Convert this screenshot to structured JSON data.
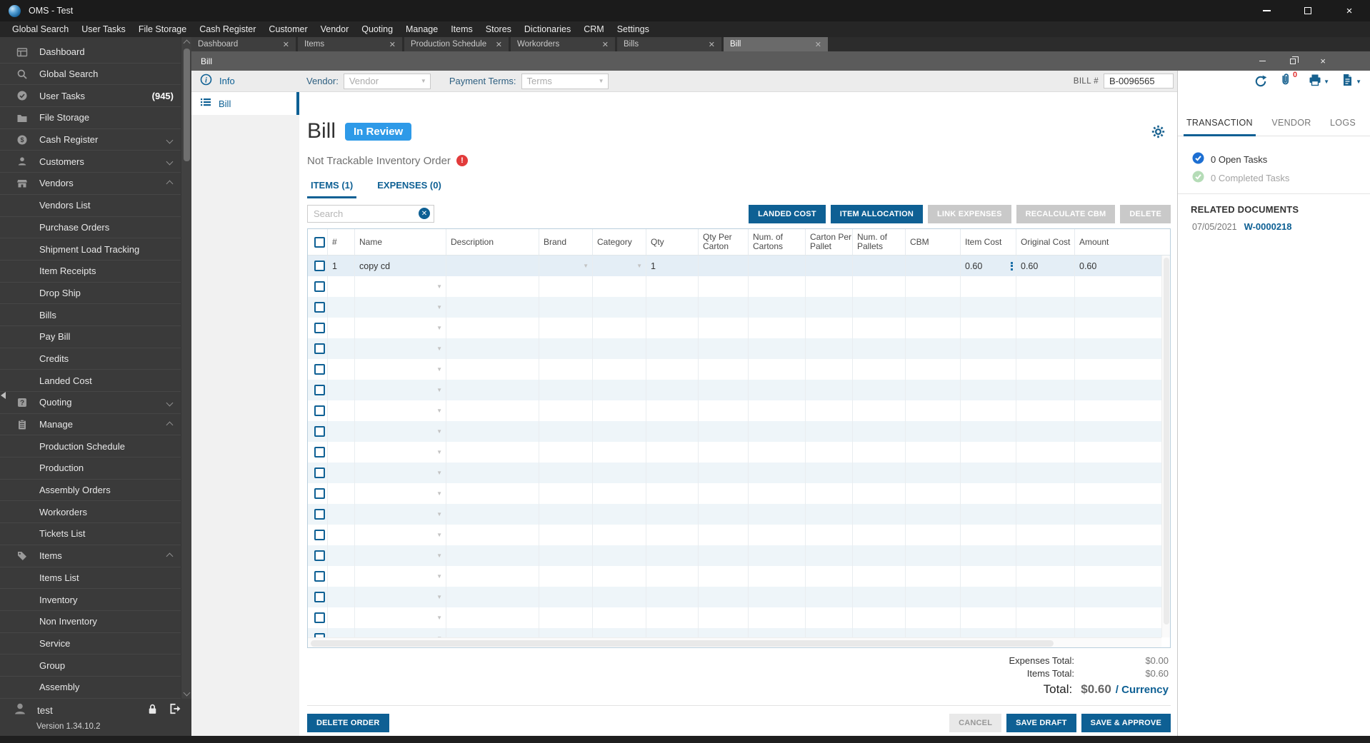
{
  "window": {
    "title": "OMS - Test"
  },
  "menu_bar": [
    "Global Search",
    "User Tasks",
    "File Storage",
    "Cash Register",
    "Customer",
    "Vendor",
    "Quoting",
    "Manage",
    "Items",
    "Stores",
    "Dictionaries",
    "CRM",
    "Settings"
  ],
  "tabs": [
    {
      "label": "Dashboard",
      "active": false
    },
    {
      "label": "Items",
      "active": false
    },
    {
      "label": "Production Schedule",
      "active": false
    },
    {
      "label": "Workorders",
      "active": false
    },
    {
      "label": "Bills",
      "active": false
    },
    {
      "label": "Bill",
      "active": true
    }
  ],
  "sidebar": {
    "items": [
      {
        "label": "Dashboard",
        "icon": "dashboard-icon"
      },
      {
        "label": "Global Search",
        "icon": "search-icon"
      },
      {
        "label": "User Tasks",
        "icon": "check-circle-icon",
        "badge": "(945)"
      },
      {
        "label": "File Storage",
        "icon": "folder-icon"
      },
      {
        "label": "Cash Register",
        "icon": "dollar-circle-icon",
        "chevron": "down"
      },
      {
        "label": "Customers",
        "icon": "person-icon",
        "chevron": "down"
      },
      {
        "label": "Vendors",
        "icon": "store-icon",
        "chevron": "up"
      },
      {
        "label": "Vendors List",
        "sub": true
      },
      {
        "label": "Purchase Orders",
        "sub": true
      },
      {
        "label": "Shipment Load Tracking",
        "sub": true
      },
      {
        "label": "Item Receipts",
        "sub": true
      },
      {
        "label": "Drop Ship",
        "sub": true
      },
      {
        "label": "Bills",
        "sub": true
      },
      {
        "label": "Pay Bill",
        "sub": true
      },
      {
        "label": "Credits",
        "sub": true
      },
      {
        "label": "Landed Cost",
        "sub": true
      },
      {
        "label": "Quoting",
        "icon": "question-icon",
        "chevron": "down"
      },
      {
        "label": "Manage",
        "icon": "clipboard-icon",
        "chevron": "up"
      },
      {
        "label": "Production Schedule",
        "sub": true
      },
      {
        "label": "Production",
        "sub": true
      },
      {
        "label": "Assembly Orders",
        "sub": true
      },
      {
        "label": "Workorders",
        "sub": true
      },
      {
        "label": "Tickets List",
        "sub": true
      },
      {
        "label": "Items",
        "icon": "tag-icon",
        "chevron": "up"
      },
      {
        "label": "Items List",
        "sub": true
      },
      {
        "label": "Inventory",
        "sub": true
      },
      {
        "label": "Non Inventory",
        "sub": true
      },
      {
        "label": "Service",
        "sub": true
      },
      {
        "label": "Group",
        "sub": true
      },
      {
        "label": "Assembly",
        "sub": true
      }
    ],
    "user": {
      "name": "test",
      "version": "Version 1.34.10.2"
    }
  },
  "inner_window": {
    "title": "Bill"
  },
  "form": {
    "nav_info_label": "Info",
    "nav_bill_label": "Bill",
    "header": {
      "vendor_label": "Vendor:",
      "vendor_placeholder": "Vendor",
      "terms_label": "Payment Terms:",
      "terms_placeholder": "Terms",
      "bill_no_label": "BILL #",
      "bill_no_value": "B-0096565",
      "attachment_count": "0"
    },
    "title": "Bill",
    "status_badge": "In Review",
    "warning": "Not Trackable Inventory Order",
    "tabs": [
      {
        "label": "ITEMS (1)",
        "active": true
      },
      {
        "label": "EXPENSES (0)",
        "active": false
      }
    ],
    "search_placeholder": "Search",
    "actions": [
      {
        "label": "LANDED COST",
        "enabled": true
      },
      {
        "label": "ITEM ALLOCATION",
        "enabled": true
      },
      {
        "label": "LINK EXPENSES",
        "enabled": false
      },
      {
        "label": "RECALCULATE CBM",
        "enabled": false
      },
      {
        "label": "DELETE",
        "enabled": false
      }
    ],
    "table": {
      "columns": [
        "#",
        "Name",
        "Description",
        "Brand",
        "Category",
        "Qty",
        "Qty Per Carton",
        "Num. of Cartons",
        "Carton Per Pallet",
        "Num. of Pallets",
        "CBM",
        "Item Cost",
        "Original Cost",
        "Amount"
      ],
      "rows": [
        {
          "num": "1",
          "name": "copy cd",
          "description": "",
          "brand": "",
          "category": "",
          "qty": "1",
          "qty_per_carton": "",
          "num_of_cartons": "",
          "carton_per_pallet": "",
          "num_of_pallets": "",
          "cbm": "",
          "item_cost": "0.60",
          "original_cost": "0.60",
          "amount": "0.60"
        }
      ],
      "empty_row_count": 18
    },
    "totals": {
      "expenses_label": "Expenses Total:",
      "expenses_value": "$0.00",
      "items_label": "Items Total:",
      "items_value": "$0.60",
      "total_label": "Total:",
      "total_value": "$0.60",
      "currency_link": "/ Currency"
    },
    "footer": {
      "delete_order": "DELETE ORDER",
      "cancel": "CANCEL",
      "save_draft": "SAVE DRAFT",
      "save_approve": "SAVE & APPROVE"
    }
  },
  "right_panel": {
    "tabs": [
      {
        "label": "TRANSACTION",
        "active": true
      },
      {
        "label": "VENDOR",
        "active": false
      },
      {
        "label": "LOGS",
        "active": false
      }
    ],
    "open_tasks": "0 Open Tasks",
    "completed_tasks": "0 Completed Tasks",
    "related_documents_title": "RELATED DOCUMENTS",
    "documents": [
      {
        "date": "07/05/2021",
        "number": "W-0000218"
      }
    ]
  },
  "colors": {
    "accent": "#0e6094",
    "badge": "#2e9ae8",
    "danger": "#e23b3b",
    "link": "#0e6094"
  }
}
